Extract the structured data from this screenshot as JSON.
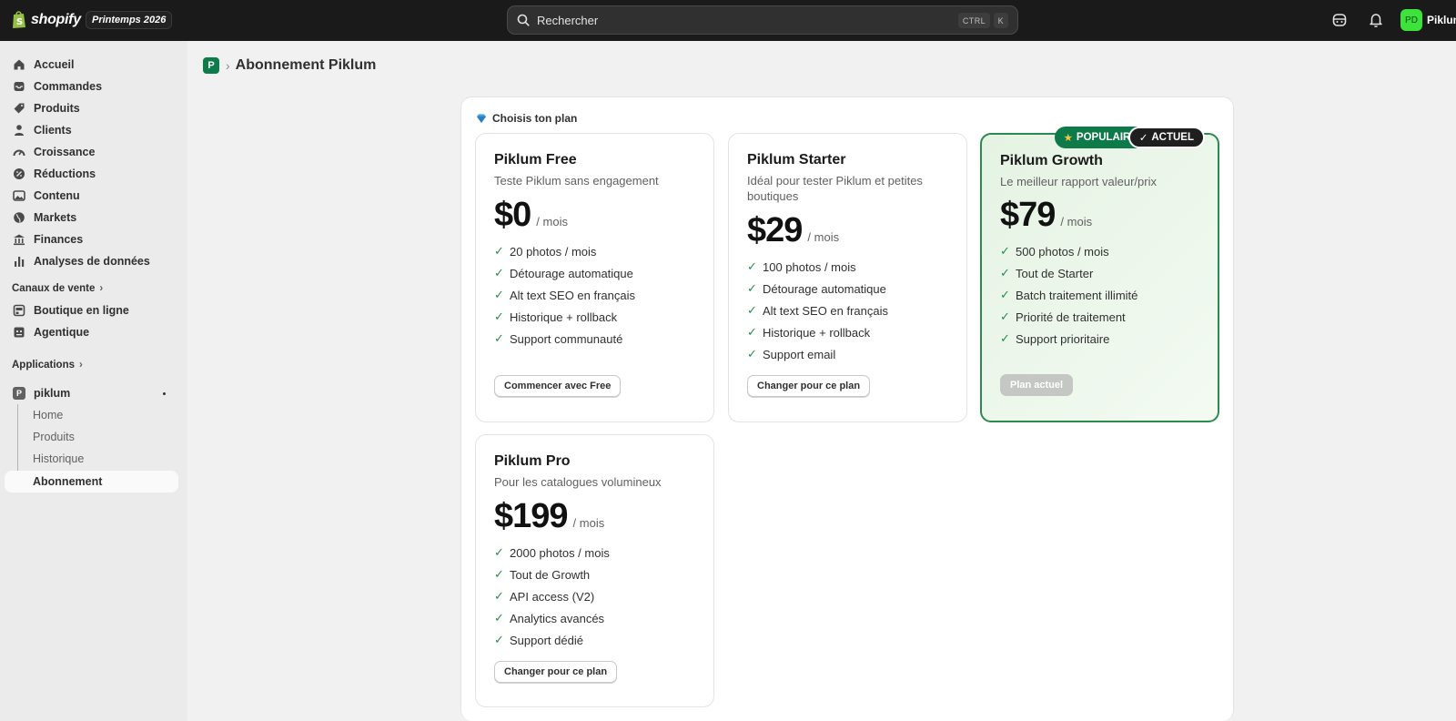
{
  "topbar": {
    "brand": "shopify",
    "edition": "Printemps 2026",
    "search_placeholder": "Rechercher",
    "shortcut_ctrl": "CTRL",
    "shortcut_key": "K",
    "avatar_initials": "PD",
    "store_name": "Piklum"
  },
  "sidebar": {
    "items": [
      {
        "label": "Accueil",
        "icon": "home-icon"
      },
      {
        "label": "Commandes",
        "icon": "inbox-icon"
      },
      {
        "label": "Produits",
        "icon": "tag-icon"
      },
      {
        "label": "Clients",
        "icon": "person-icon"
      },
      {
        "label": "Croissance",
        "icon": "gauge-icon"
      },
      {
        "label": "Réductions",
        "icon": "discount-icon"
      },
      {
        "label": "Contenu",
        "icon": "image-icon"
      },
      {
        "label": "Markets",
        "icon": "globe-icon"
      },
      {
        "label": "Finances",
        "icon": "bank-icon"
      },
      {
        "label": "Analyses de données",
        "icon": "bar-chart-icon"
      }
    ],
    "sales_channels_title": "Canaux de vente",
    "sales_channels": [
      {
        "label": "Boutique en ligne",
        "icon": "store-icon"
      },
      {
        "label": "Agentique",
        "icon": "robot-icon"
      }
    ],
    "apps_title": "Applications",
    "app": {
      "label": "piklum",
      "icon_letter": "P"
    },
    "app_subitems": [
      "Home",
      "Produits",
      "Historique",
      "Abonnement"
    ]
  },
  "breadcrumb": {
    "icon_letter": "P",
    "separator": "›",
    "title": "Abonnement Piklum"
  },
  "panel": {
    "heading": "Choisis ton plan",
    "plans": [
      {
        "name": "Piklum Free",
        "description": "Teste Piklum sans engagement",
        "price": "$0",
        "unit": "/ mois",
        "features": [
          "20 photos / mois",
          "Détourage automatique",
          "Alt text SEO en français",
          "Historique + rollback",
          "Support communauté"
        ],
        "button": "Commencer avec Free"
      },
      {
        "name": "Piklum Starter",
        "description": "Idéal pour tester Piklum et petites boutiques",
        "price": "$29",
        "unit": "/ mois",
        "features": [
          "100 photos / mois",
          "Détourage automatique",
          "Alt text SEO en français",
          "Historique + rollback",
          "Support email"
        ],
        "button": "Changer pour ce plan"
      },
      {
        "name": "Piklum Growth",
        "description": "Le meilleur rapport valeur/prix",
        "price": "$79",
        "unit": "/ mois",
        "features": [
          "500 photos / mois",
          "Tout de Starter",
          "Batch traitement illimité",
          "Priorité de traitement",
          "Support prioritaire"
        ],
        "button": "Plan actuel",
        "badge_popular": "POPULAIRE",
        "badge_current": "ACTUEL"
      },
      {
        "name": "Piklum Pro",
        "description": "Pour les catalogues volumineux",
        "price": "$199",
        "unit": "/ mois",
        "features": [
          "2000 photos / mois",
          "Tout de Growth",
          "API access (V2)",
          "Analytics avancés",
          "Support dédié"
        ],
        "button": "Changer pour ce plan"
      }
    ]
  },
  "colors": {
    "topbar": "#1a1a1a",
    "accent_green": "#2a8a4f",
    "popular_badge": "#0e7a4a",
    "avatar": "#3be33b"
  }
}
